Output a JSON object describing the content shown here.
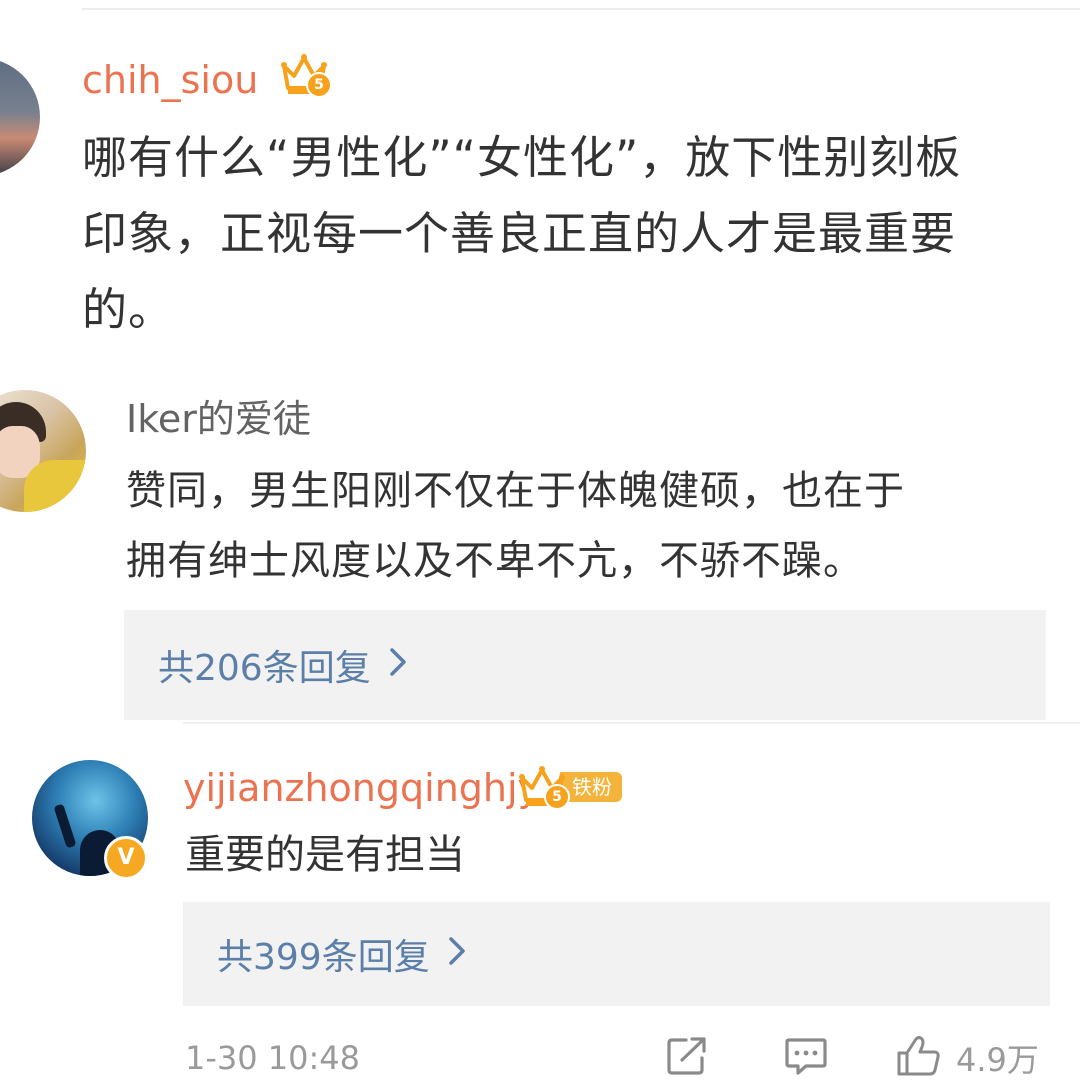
{
  "comment": {
    "username": "chih_siou",
    "vip_level": "5",
    "text_lines": [
      "哪有什么“男性化”“女性化”，放下性别刻板",
      "印象，正视每一个善良正直的人才是最重要",
      "的。"
    ]
  },
  "replies": [
    {
      "username": "Iker的爱徒",
      "text_lines": [
        "赞同，男生阳刚不仅在于体魄健硕，也在于",
        "拥有绅士风度以及不卑不亢，不骄不躁。"
      ],
      "more_replies_label": "共206条回复"
    },
    {
      "username": "yijianzhongqinghjy",
      "vip_level": "5",
      "fan_badge": "铁粉",
      "verified_mark": "V",
      "text": "重要的是有担当",
      "more_replies_label": "共399条回复"
    }
  ],
  "footer": {
    "timestamp": "1-30 10:48",
    "like_count": "4.9万"
  },
  "icons": {
    "share": "share-icon",
    "comment": "comment-icon",
    "like": "like-icon",
    "chevron": "chevron-right-icon",
    "crown": "crown-icon"
  },
  "colors": {
    "vip_username": "#eb7350",
    "normal_username": "#636363",
    "link": "#5b7fa8",
    "reply_box_bg": "#f2f2f2",
    "crown_gold": "#f6a21c"
  }
}
